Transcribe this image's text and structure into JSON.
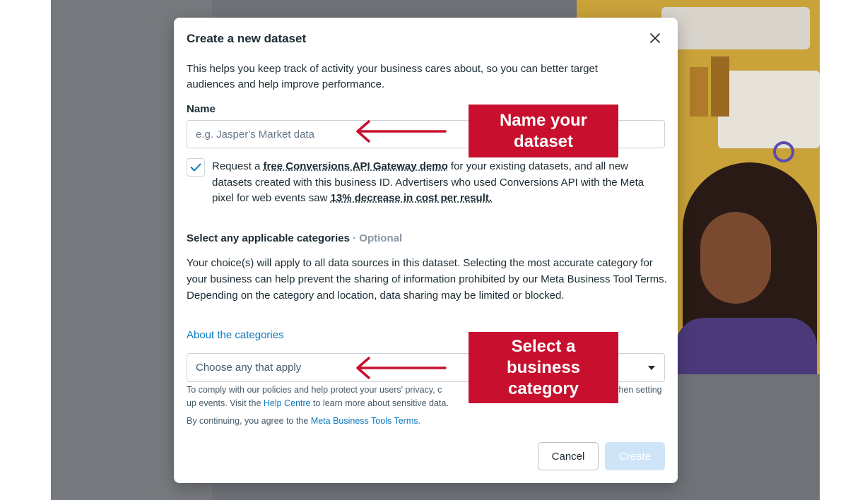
{
  "modal": {
    "title": "Create a new dataset",
    "intro": "This helps you keep track of activity your business cares about, so you can better target audiences and help improve performance.",
    "name_label": "Name",
    "name_placeholder": "e.g. Jasper's Market data",
    "checkbox_checked": true,
    "demo": {
      "part1": "Request a ",
      "link1": "free Conversions API Gateway demo",
      "part2": " for your existing datasets, and all new datasets created with this business ID. Advertisers who used Conversions API with the Meta pixel for web events saw ",
      "link2": "13% decrease in cost per result."
    },
    "categories_heading": "Select any applicable categories",
    "categories_optional": "· Optional",
    "categories_desc": "Your choice(s) will apply to all data sources in this dataset. Selecting the most accurate category for your business can help prevent the sharing of information prohibited by our Meta Business Tool Terms. Depending on the category and location, data sharing may be limited or blocked.",
    "about_link": "About the categories",
    "select_placeholder": "Choose any that apply",
    "comply": {
      "text1": "To comply with our policies and help protect your users' privacy, c",
      "text2": "n us when setting up events. Visit the ",
      "link": "Help Centre",
      "text3": " to learn more about sensitive data."
    },
    "terms": {
      "text": "By continuing, you agree to the ",
      "link": "Meta Business Tools Terms",
      "end": "."
    },
    "cancel_label": "Cancel",
    "create_label": "Create"
  },
  "annotations": {
    "callout_name": "Name your dataset",
    "callout_category": "Select a business category",
    "color": "#c8102e"
  },
  "icons": {
    "close": "close-icon",
    "check": "check-icon",
    "dropdown": "caret-down-icon"
  }
}
